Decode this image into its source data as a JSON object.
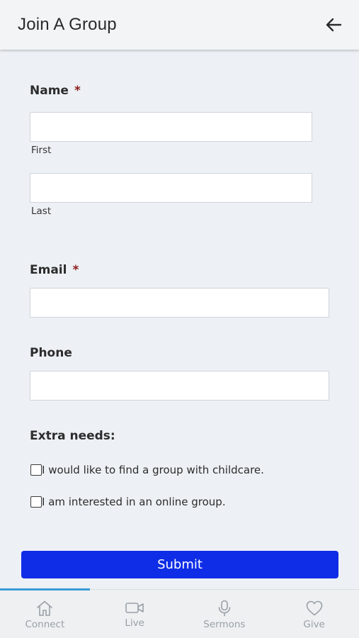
{
  "header": {
    "title": "Join A Group",
    "back_icon": "arrow-left-icon"
  },
  "form": {
    "name": {
      "label": "Name",
      "required_mark": "*",
      "first_value": "",
      "first_sublabel": "First",
      "last_value": "",
      "last_sublabel": "Last"
    },
    "email": {
      "label": "Email",
      "required_mark": "*",
      "value": ""
    },
    "phone": {
      "label": "Phone",
      "value": ""
    },
    "extra_needs": {
      "label": "Extra needs:",
      "options": [
        {
          "label": "I would like to find a group with childcare.",
          "checked": false
        },
        {
          "label": "I am interested in an online group.",
          "checked": false
        }
      ]
    },
    "submit_label": "Submit"
  },
  "tabbar": {
    "active_color": "#3a9ad9",
    "tabs": [
      {
        "label": "Connect",
        "icon": "home-icon",
        "active": true
      },
      {
        "label": "Live",
        "icon": "video-camera-icon",
        "active": false
      },
      {
        "label": "Sermons",
        "icon": "microphone-icon",
        "active": false
      },
      {
        "label": "Give",
        "icon": "heart-icon",
        "active": false
      }
    ]
  },
  "colors": {
    "submit_button": "#0f2de6",
    "background": "#edf1f5",
    "required_mark": "#8b1b1b"
  }
}
